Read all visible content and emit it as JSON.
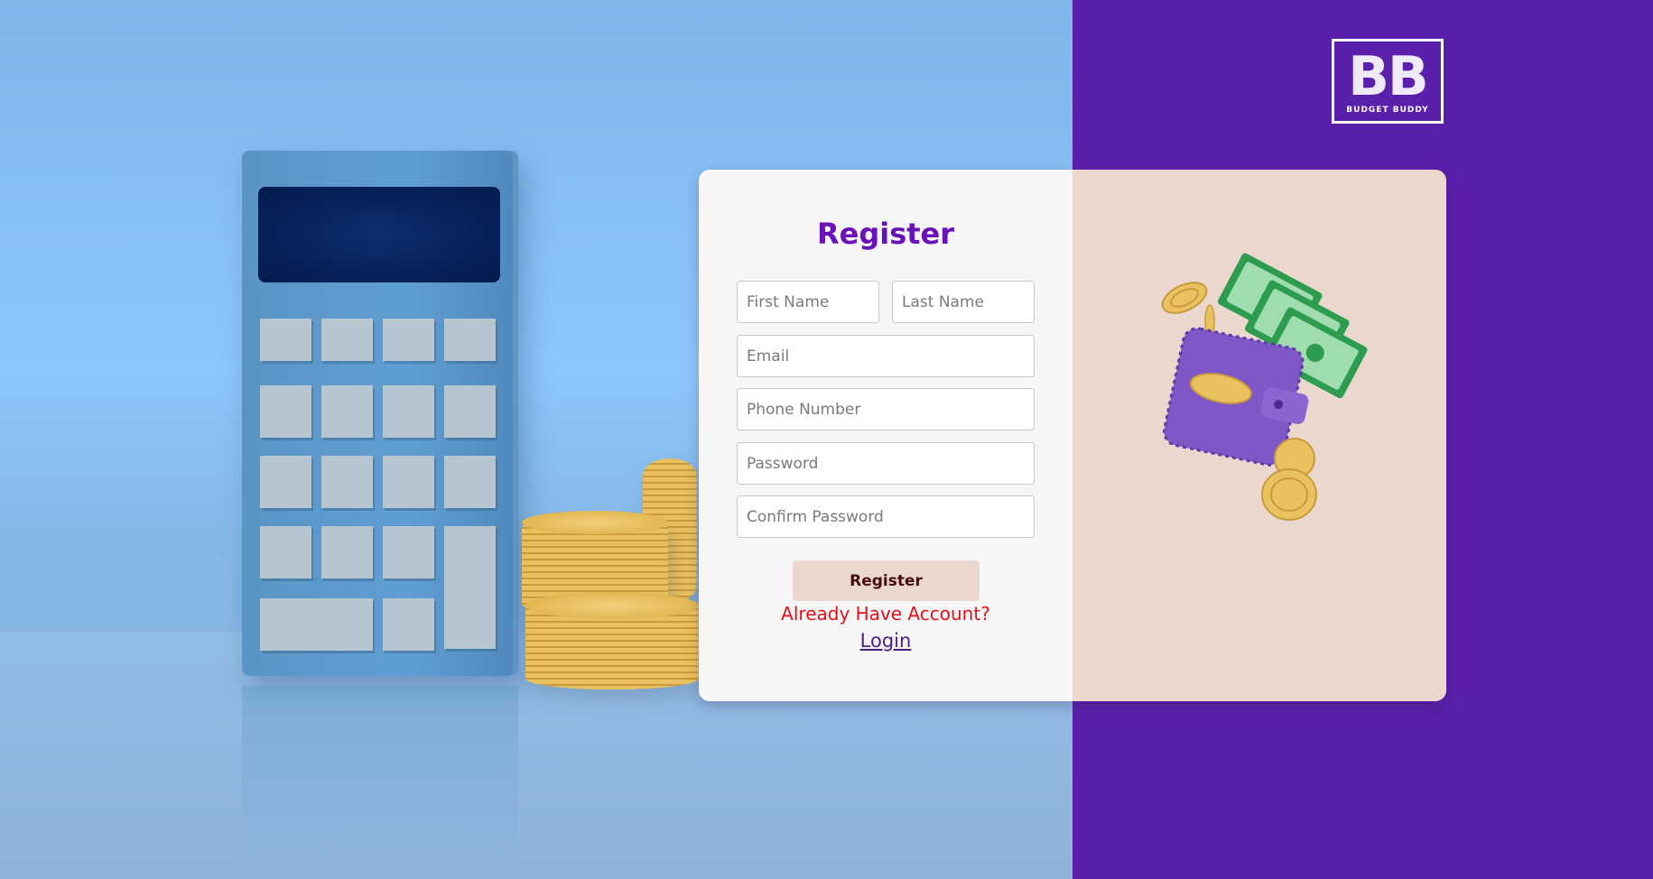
{
  "brand": {
    "logo_mark": "BB",
    "logo_text": "BUDGET BUDDY"
  },
  "form": {
    "title": "Register",
    "first_name_placeholder": "First Name",
    "last_name_placeholder": "Last Name",
    "email_placeholder": "Email",
    "phone_placeholder": "Phone Number",
    "password_placeholder": "Password",
    "confirm_password_placeholder": "Confirm Password",
    "submit_label": "Register",
    "already_text": "Already Have Account?",
    "login_label": "Login"
  },
  "colors": {
    "purple_panel": "#5a1fab",
    "title": "#6a12b8",
    "card_left": "#f6f6f6",
    "card_right": "#ead8cf",
    "button_bg": "#ead8cf",
    "already_text": "#e3101c",
    "login_link": "#4a1f86"
  },
  "icons": {
    "illustration": "wallet-with-cash-and-coins",
    "background": "calculator-and-coin-stacks"
  }
}
